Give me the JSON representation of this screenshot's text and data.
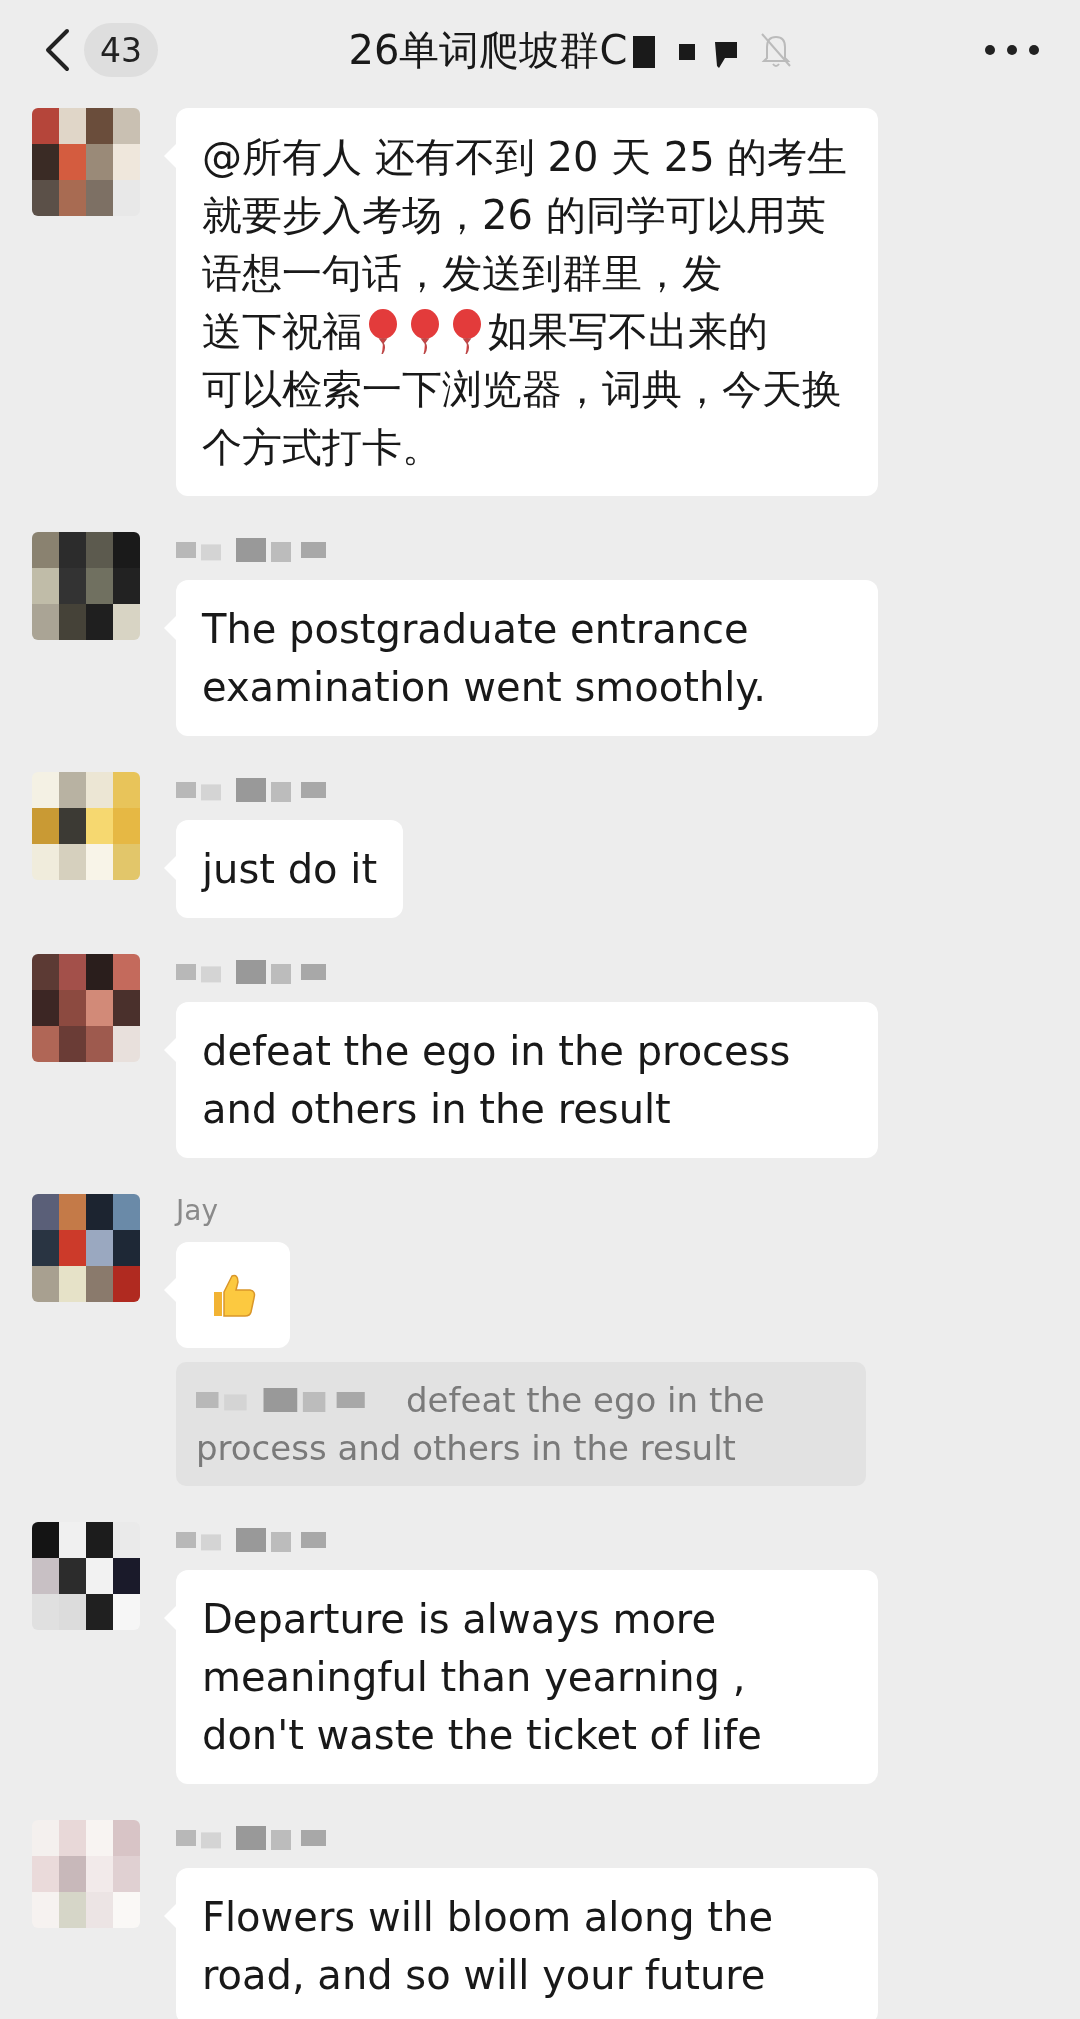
{
  "header": {
    "back_count": "43",
    "title": "26单词爬坡群C",
    "muted": true
  },
  "messages": [
    {
      "sender": {
        "kind": "none"
      },
      "lines": [
        [
          {
            "kind": "text",
            "text": "@所有人  还有不到 20 天 25 的考生就要步入考场，26 的同学可以用英语想一句话，发送到群里，发"
          }
        ],
        [
          {
            "kind": "text",
            "text": "送下祝福"
          },
          {
            "kind": "balloon"
          },
          {
            "kind": "balloon"
          },
          {
            "kind": "balloon"
          },
          {
            "kind": "text",
            "text": "如果写不出来的"
          }
        ],
        [
          {
            "kind": "text",
            "text": "可以检索一下浏览器，词典，今天换个方式打卡。"
          }
        ]
      ]
    },
    {
      "sender": {
        "kind": "redacted"
      },
      "lines": [
        [
          {
            "kind": "text",
            "text": "The postgraduate entrance examination went smoothly."
          }
        ]
      ]
    },
    {
      "sender": {
        "kind": "redacted"
      },
      "lines": [
        [
          {
            "kind": "text",
            "text": "just do it"
          }
        ]
      ]
    },
    {
      "sender": {
        "kind": "redacted"
      },
      "lines": [
        [
          {
            "kind": "text",
            "text": "defeat the ego in the process and others in the result"
          }
        ]
      ]
    },
    {
      "sender": {
        "kind": "name",
        "text": "Jay"
      },
      "lines": [
        [
          {
            "kind": "thumbs_up"
          }
        ]
      ],
      "quote": {
        "sender": {
          "kind": "redacted"
        },
        "lines": [
          "defeat the ego in the",
          "process and others in the result"
        ]
      }
    },
    {
      "sender": {
        "kind": "redacted"
      },
      "lines": [
        [
          {
            "kind": "text",
            "text": "Departure is always more meaningful than yearning , don't waste the ticket of life"
          }
        ]
      ]
    },
    {
      "sender": {
        "kind": "redacted"
      },
      "lines": [
        [
          {
            "kind": "text",
            "text": "Flowers will bloom along the road, and so will your future"
          }
        ]
      ]
    }
  ]
}
